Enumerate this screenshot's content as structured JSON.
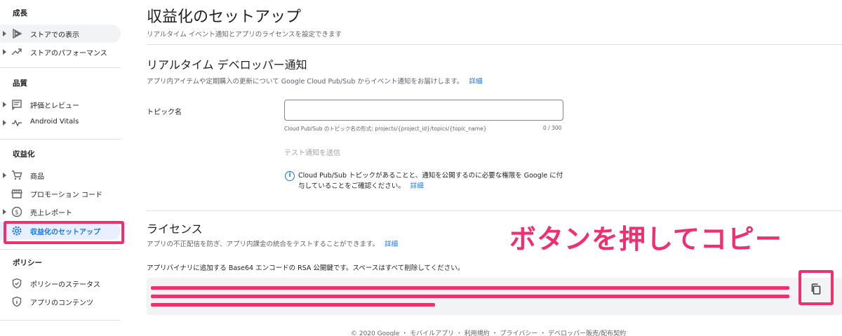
{
  "sidebar": {
    "sections": [
      {
        "title": "成長",
        "items": [
          {
            "label": "ストアでの表示",
            "icon": "play-icon"
          },
          {
            "label": "ストアのパフォーマンス",
            "icon": "trending-up-icon"
          }
        ]
      },
      {
        "title": "品質",
        "items": [
          {
            "label": "評価とレビュー",
            "icon": "review-icon"
          },
          {
            "label": "Android Vitals",
            "icon": "vitals-icon"
          }
        ]
      },
      {
        "title": "収益化",
        "items": [
          {
            "label": "商品",
            "icon": "cart-icon"
          },
          {
            "label": "プロモーション コード",
            "icon": "store-icon"
          },
          {
            "label": "売上レポート",
            "icon": "dollar-icon"
          },
          {
            "label": "収益化のセットアップ",
            "icon": "gear-icon"
          }
        ]
      },
      {
        "title": "ポリシー",
        "items": [
          {
            "label": "ポリシーのステータス",
            "icon": "shield-icon"
          },
          {
            "label": "アプリのコンテンツ",
            "icon": "info-icon"
          }
        ]
      }
    ]
  },
  "main": {
    "title": "収益化のセットアップ",
    "subtitle": "リアルタイム イベント通知とアプリのライセンスを設定できます",
    "rtdn": {
      "heading": "リアルタイム デベロッパー通知",
      "description": "アプリ内アイテムや定期購入の更新について Google Cloud Pub/Sub からイベント通知をお届けします。",
      "link": "詳細",
      "topic_label": "トピック名",
      "topic_value": "",
      "topic_hint": "Cloud Pub/Sub のトピック名の形式: projects/{project_id}/topics/{topic_name}",
      "topic_counter": "0 / 300",
      "test_button": "テスト通知を送信",
      "info_text": "Cloud Pub/Sub トピックがあることと、通知を公開するのに必要な権限を Google に付与していることをご確認ください。",
      "info_link": "詳細"
    },
    "license": {
      "heading": "ライセンス",
      "description": "アプリの不正配信を防ぎ、アプリ内課金の統合をテストすることができます。",
      "link": "詳細",
      "key_label": "アプリバイナリに追加する Base64 エンコードの RSA 公開鍵です。スペースはすべて削除してください。"
    },
    "annotation": "ボタンを押してコピー",
    "footer": "© 2020 Google ・ モバイルアプリ ・ 利用規約 ・ プライバシー ・ デベロッパー販売/配布契約"
  },
  "colors": {
    "accent": "#1a73e8",
    "highlight": "#f0306e",
    "active_bg": "#e8f0fe"
  }
}
